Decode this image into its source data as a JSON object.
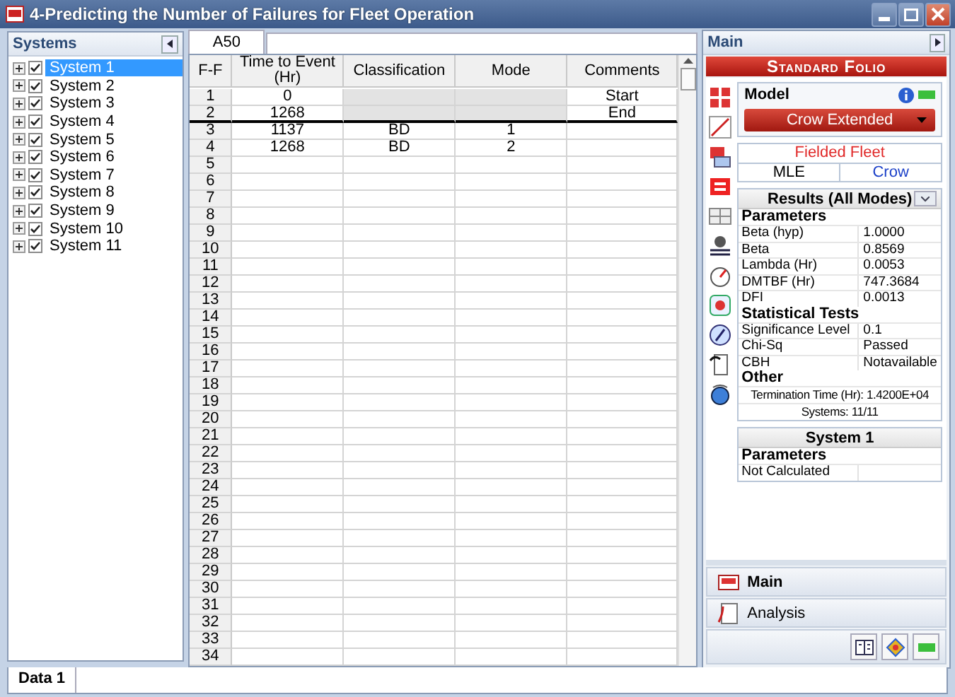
{
  "window": {
    "title": "4-Predicting the Number of Failures for Fleet Operation"
  },
  "systems": {
    "title": "Systems",
    "items": [
      {
        "label": "System 1",
        "checked": true,
        "selected": true
      },
      {
        "label": "System 2",
        "checked": true,
        "selected": false
      },
      {
        "label": "System 3",
        "checked": true,
        "selected": false
      },
      {
        "label": "System 4",
        "checked": true,
        "selected": false
      },
      {
        "label": "System 5",
        "checked": true,
        "selected": false
      },
      {
        "label": "System 6",
        "checked": true,
        "selected": false
      },
      {
        "label": "System 7",
        "checked": true,
        "selected": false
      },
      {
        "label": "System 8",
        "checked": true,
        "selected": false
      },
      {
        "label": "System 9",
        "checked": true,
        "selected": false
      },
      {
        "label": "System 10",
        "checked": true,
        "selected": false
      },
      {
        "label": "System 11",
        "checked": true,
        "selected": false
      }
    ]
  },
  "grid": {
    "cell_ref": "A50",
    "columns": [
      "F-F",
      "Time to Event (Hr)",
      "Classification",
      "Mode",
      "Comments"
    ],
    "rows": [
      {
        "index": "1",
        "time": "0",
        "comments": "Start",
        "disabled": true
      },
      {
        "index": "2",
        "time": "1268",
        "comments": "End",
        "disabled": true
      },
      {
        "index": "3",
        "time": "1137",
        "classification": "BD",
        "mode": "1",
        "disabled": false
      },
      {
        "index": "4",
        "time": "1268",
        "classification": "BD",
        "mode": "2",
        "disabled": false
      },
      {
        "index": "5"
      },
      {
        "index": "6"
      },
      {
        "index": "7"
      },
      {
        "index": "8"
      },
      {
        "index": "9"
      },
      {
        "index": "10"
      },
      {
        "index": "11"
      },
      {
        "index": "12"
      },
      {
        "index": "13"
      },
      {
        "index": "14"
      },
      {
        "index": "15"
      },
      {
        "index": "16"
      },
      {
        "index": "17"
      },
      {
        "index": "18"
      },
      {
        "index": "19"
      },
      {
        "index": "20"
      },
      {
        "index": "21"
      },
      {
        "index": "22"
      },
      {
        "index": "23"
      },
      {
        "index": "24"
      },
      {
        "index": "25"
      },
      {
        "index": "26"
      },
      {
        "index": "27"
      },
      {
        "index": "28"
      },
      {
        "index": "29"
      },
      {
        "index": "30"
      },
      {
        "index": "31"
      },
      {
        "index": "32"
      },
      {
        "index": "33"
      },
      {
        "index": "34"
      }
    ]
  },
  "folio": {
    "panel_title": "Main",
    "banner": "Standard Folio",
    "model": {
      "title": "Model",
      "value": "Crow Extended"
    },
    "data_type": "Fielded Fleet",
    "settings": [
      "MLE",
      "Crow"
    ],
    "results": {
      "title": "Results (All Modes)",
      "sections": [
        {
          "title": "Parameters",
          "rows": [
            {
              "label": "Beta (hyp)",
              "value": "1.0000"
            },
            {
              "label": "Beta",
              "value": "0.8569"
            },
            {
              "label": "Lambda (Hr)",
              "value": "0.0053"
            },
            {
              "label": "DMTBF (Hr)",
              "value": "747.3684"
            },
            {
              "label": "DFI",
              "value": "0.0013"
            }
          ]
        },
        {
          "title": "Statistical Tests",
          "rows": [
            {
              "label": "Significance Level",
              "value": "0.1"
            },
            {
              "label": "Chi-Sq",
              "value": "Passed"
            },
            {
              "label": "CBH",
              "value": "Notavailable"
            }
          ]
        },
        {
          "title": "Other",
          "lines": [
            "Termination Time (Hr): 1.4200E+04",
            "Systems: 11/11"
          ]
        }
      ]
    },
    "system_box": {
      "title": "System 1",
      "section": "Parameters",
      "rows": [
        {
          "label": "Not Calculated"
        }
      ]
    },
    "nav": [
      {
        "label": "Main",
        "selected": true
      },
      {
        "label": "Analysis",
        "selected": false
      }
    ]
  },
  "sheet_tabs": [
    {
      "label": "Data 1",
      "selected": true
    }
  ]
}
